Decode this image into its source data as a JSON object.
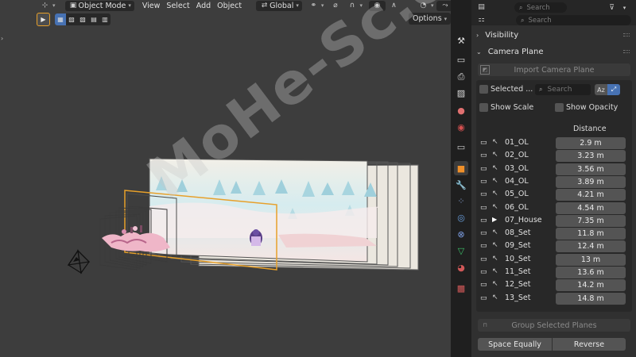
{
  "viewport": {
    "header": {
      "mode_label": "Object Mode",
      "menus": [
        "View",
        "Select",
        "Add",
        "Object"
      ],
      "transform_orientation": "Global"
    },
    "options_label": "Options",
    "watermark": "MoHe-Sc.com"
  },
  "properties": {
    "search_placeholder_top": "Search",
    "search_placeholder_second": "Search",
    "visibility_label": "Visibility",
    "camera_plane_label": "Camera Plane",
    "import_label": "Import Camera Plane",
    "selected_label": "Selected ...",
    "filter_search_placeholder": "Search",
    "az_label": "Az",
    "show_scale_label": "Show Scale",
    "show_opacity_label": "Show Opacity",
    "distance_header": "Distance",
    "planes": [
      {
        "name": "01_OL",
        "distance": "2.9 m",
        "selected": false
      },
      {
        "name": "02_OL",
        "distance": "3.23 m",
        "selected": false
      },
      {
        "name": "03_OL",
        "distance": "3.56 m",
        "selected": false
      },
      {
        "name": "04_OL",
        "distance": "3.89 m",
        "selected": false
      },
      {
        "name": "05_OL",
        "distance": "4.21 m",
        "selected": false
      },
      {
        "name": "06_OL",
        "distance": "4.54 m",
        "selected": false
      },
      {
        "name": "07_House",
        "distance": "7.35 m",
        "selected": true
      },
      {
        "name": "08_Set",
        "distance": "11.8 m",
        "selected": false
      },
      {
        "name": "09_Set",
        "distance": "12.4 m",
        "selected": false
      },
      {
        "name": "10_Set",
        "distance": "13 m",
        "selected": false
      },
      {
        "name": "11_Set",
        "distance": "13.6 m",
        "selected": false
      },
      {
        "name": "12_Set",
        "distance": "14.2 m",
        "selected": false
      },
      {
        "name": "13_Set",
        "distance": "14.8 m",
        "selected": false
      }
    ],
    "group_label": "Group Selected Planes",
    "space_equally_label": "Space Equally",
    "reverse_label": "Reverse"
  },
  "colors": {
    "accent_blue": "#4772b3",
    "active_orange": "#e7a02a",
    "panel_bg": "#303030",
    "viewport_bg": "#3d3d3d"
  }
}
